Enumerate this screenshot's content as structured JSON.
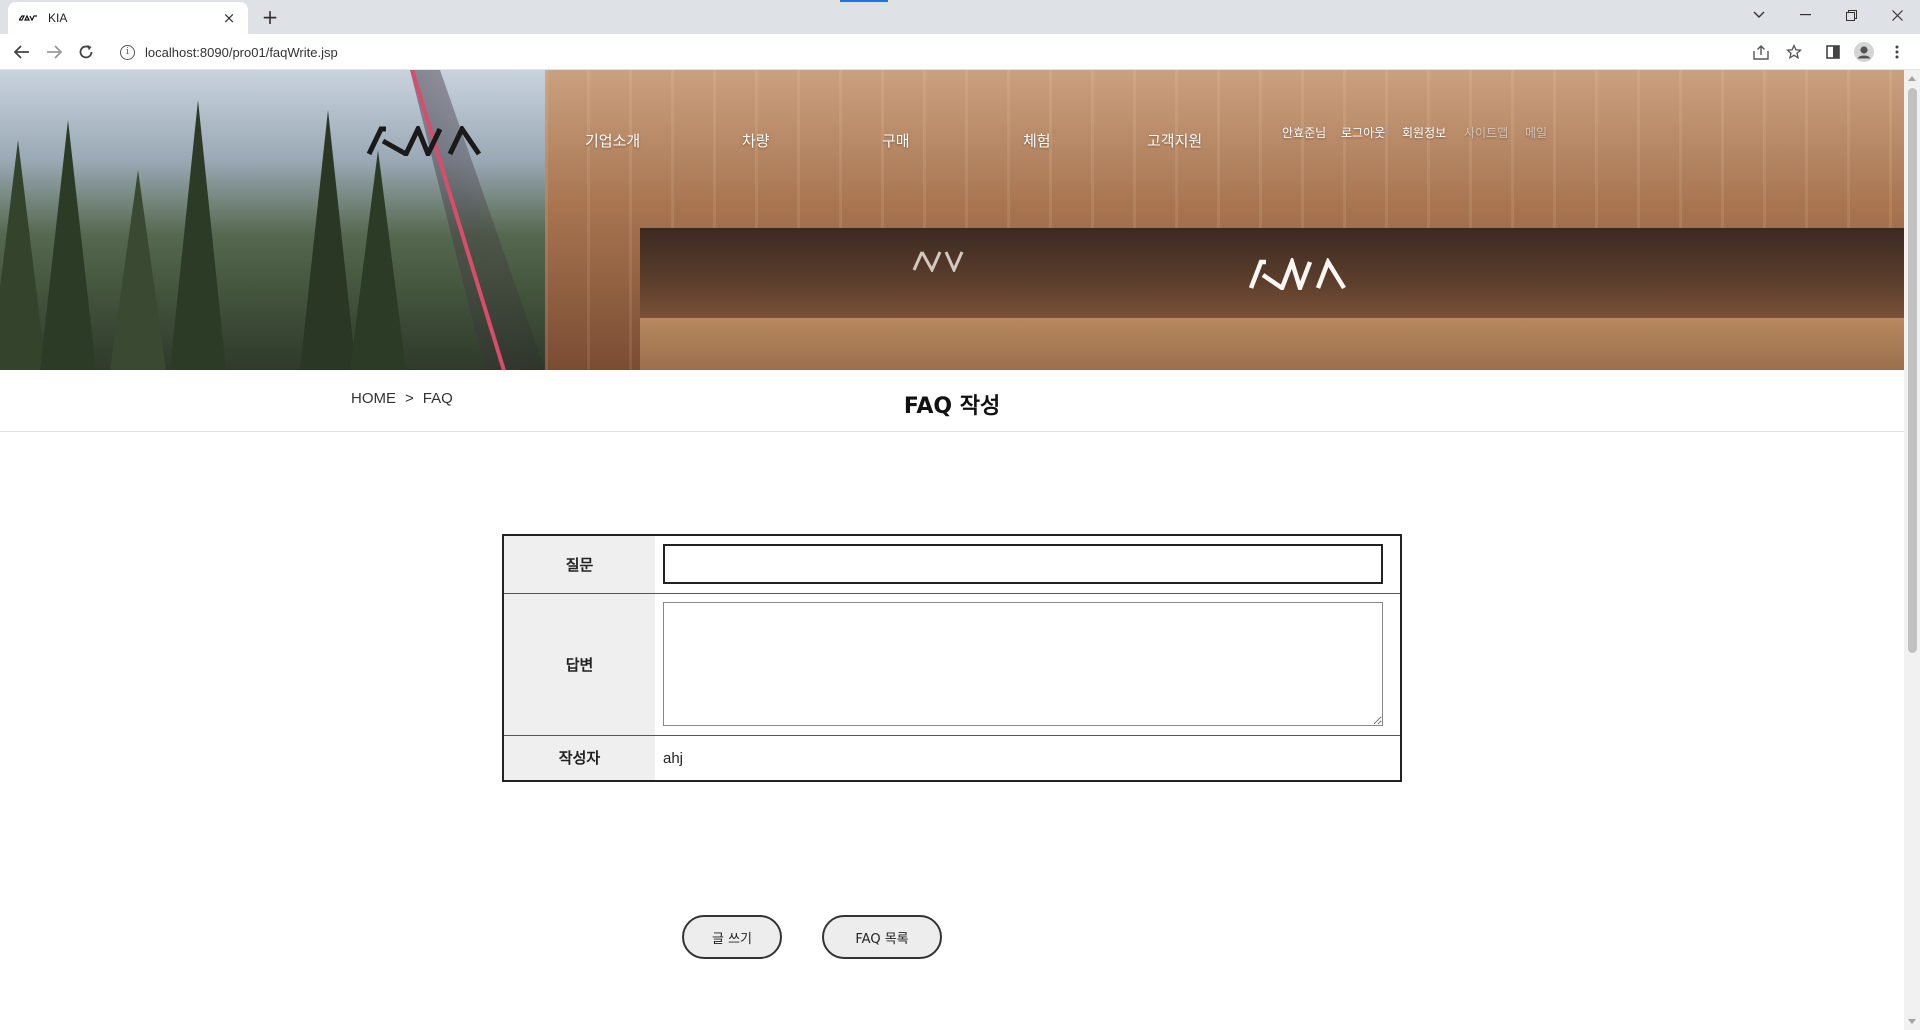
{
  "browser": {
    "tab_title": "KIA",
    "url": "localhost:8090/pro01/faqWrite.jsp",
    "new_tab": "+",
    "close_tab": "×"
  },
  "header": {
    "logo_text": "KIA",
    "nav": [
      "기업소개",
      "차량",
      "구매",
      "체험",
      "고객지원"
    ],
    "utility": [
      "안효준님",
      "로그아웃",
      "회원정보",
      "사이트맵",
      "메일"
    ]
  },
  "breadcrumb": {
    "home": "HOME",
    "separator": ">",
    "current": "FAQ"
  },
  "page": {
    "title": "FAQ 작성"
  },
  "form": {
    "question_label": "질문",
    "question_value": "",
    "answer_label": "답변",
    "answer_value": "",
    "writer_label": "작성자",
    "writer_value": "ahj"
  },
  "buttons": {
    "submit": "글 쓰기",
    "list": "FAQ 목록"
  },
  "colors": {
    "table_border": "#222222",
    "label_bg": "#efefef",
    "button_bg": "#ededed",
    "accent_line": "#d84d6b"
  }
}
